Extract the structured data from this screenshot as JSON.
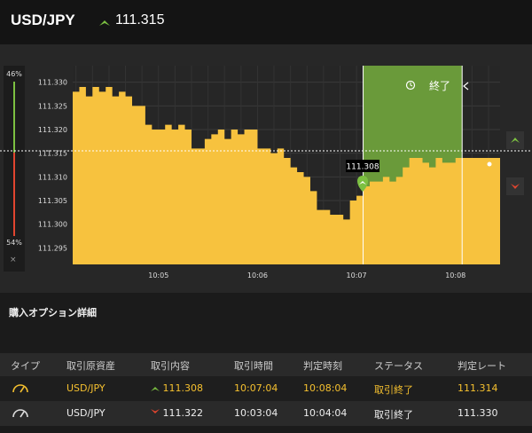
{
  "header": {
    "pair": "USD/JPY",
    "direction_icon": "up-arrow-icon",
    "rate": "111.315"
  },
  "side_panel": {
    "percent_up": "46%",
    "percent_down": "54%",
    "close_label": "×"
  },
  "chart": {
    "end_label": "終了",
    "current_price_label": "111.308",
    "colors": {
      "area": "#f7c23e",
      "active_window": "#6a9a3a",
      "up": "#7cc041",
      "down": "#e2452f"
    }
  },
  "chart_data": {
    "type": "area",
    "y_ticks": [
      "111.330",
      "111.325",
      "111.320",
      "111.315",
      "111.310",
      "111.305",
      "111.300",
      "111.295"
    ],
    "ylim": [
      111.2915,
      111.3335
    ],
    "x_ticks": [
      "10:05",
      "10:06",
      "10:07",
      "10:08"
    ],
    "xlim": [
      "10:04:08",
      "10:08:27"
    ],
    "reference_line": 111.3155,
    "series": [
      {
        "x": [
          "10:04:08",
          "10:04:12",
          "10:04:16",
          "10:04:20",
          "10:04:24",
          "10:04:28",
          "10:04:32",
          "10:04:36",
          "10:04:40",
          "10:04:44",
          "10:04:48",
          "10:04:52",
          "10:04:56",
          "10:05:00",
          "10:05:04",
          "10:05:08",
          "10:05:12",
          "10:05:16",
          "10:05:20",
          "10:05:24",
          "10:05:28",
          "10:05:32",
          "10:05:36",
          "10:05:40",
          "10:05:44",
          "10:05:48",
          "10:05:52",
          "10:05:56",
          "10:06:00",
          "10:06:04",
          "10:06:08",
          "10:06:12",
          "10:06:16",
          "10:06:20",
          "10:06:24",
          "10:06:28",
          "10:06:32",
          "10:06:36",
          "10:06:40",
          "10:06:44",
          "10:06:48",
          "10:06:52",
          "10:06:56",
          "10:07:00",
          "10:07:04",
          "10:07:08",
          "10:07:12",
          "10:07:16",
          "10:07:20",
          "10:07:24",
          "10:07:28",
          "10:07:32",
          "10:07:36",
          "10:07:40",
          "10:07:44",
          "10:07:48",
          "10:07:52",
          "10:08:00",
          "10:08:10",
          "10:08:20",
          "10:08:27"
        ],
        "y": [
          111.328,
          111.329,
          111.327,
          111.329,
          111.328,
          111.329,
          111.327,
          111.328,
          111.327,
          111.325,
          111.325,
          111.321,
          111.32,
          111.32,
          111.321,
          111.32,
          111.321,
          111.32,
          111.316,
          111.316,
          111.318,
          111.319,
          111.32,
          111.318,
          111.32,
          111.319,
          111.32,
          111.32,
          111.316,
          111.316,
          111.315,
          111.316,
          111.314,
          111.312,
          111.311,
          111.31,
          111.307,
          111.303,
          111.303,
          111.302,
          111.302,
          111.301,
          111.305,
          111.306,
          111.308,
          111.309,
          111.309,
          111.31,
          111.309,
          111.31,
          111.312,
          111.314,
          111.314,
          111.313,
          111.312,
          111.314,
          111.313,
          111.314,
          111.314,
          111.314,
          111.314
        ]
      }
    ],
    "grid": true
  },
  "section": {
    "title": "購入オプション詳細"
  },
  "table": {
    "headers": [
      "タイプ",
      "取引原資産",
      "取引内容",
      "取引時間",
      "判定時刻",
      "ステータス",
      "判定レート"
    ],
    "rows": [
      {
        "type_icon": "gauge-icon",
        "asset": "USD/JPY",
        "direction_icon": "up-arrow-icon",
        "rate": "111.308",
        "trade_time": "10:07:04",
        "judge_time": "10:08:04",
        "status": "取引終了",
        "judge_rate": "111.314"
      },
      {
        "type_icon": "gauge-icon",
        "asset": "USD/JPY",
        "direction_icon": "down-arrow-icon",
        "rate": "111.322",
        "trade_time": "10:03:04",
        "judge_time": "10:04:04",
        "status": "取引終了",
        "judge_rate": "111.330"
      }
    ]
  }
}
